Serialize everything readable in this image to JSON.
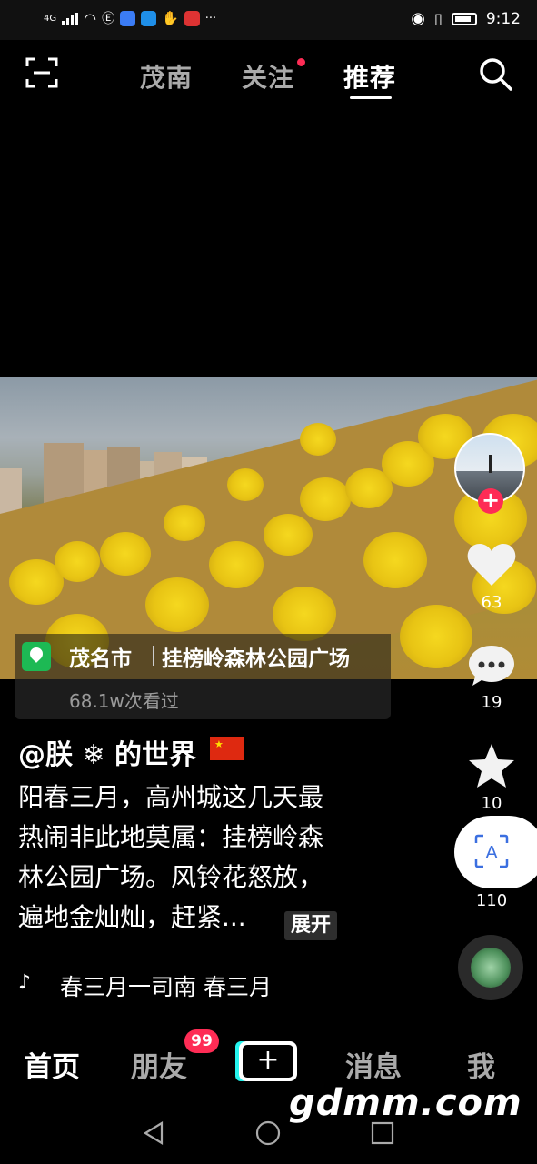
{
  "status_bar": {
    "network": "4G",
    "time": "9:12",
    "more": "···",
    "app_icon_colors": [
      "#3b7cf5",
      "#1f8fe8",
      "#d33"
    ]
  },
  "top_nav": {
    "tabs": [
      {
        "label": "茂南",
        "active": false
      },
      {
        "label": "关注",
        "active": false,
        "has_dot": true
      },
      {
        "label": "推荐",
        "active": true
      }
    ]
  },
  "location": {
    "city": "茂名市",
    "place": "挂榜岭森林公园广场",
    "views": "68.1w次看过"
  },
  "rail": {
    "likes": "63",
    "comments": "19",
    "favorites": "10",
    "shares": "110",
    "ocr_label": "A"
  },
  "post": {
    "author": "@朕 ❄ 的世界",
    "caption_lines": [
      "阳春三月，高州城这几天最",
      "热闹非此地莫属：挂榜岭森",
      "林公园广场。风铃花怒放，",
      "遍地金灿灿，赶紧..."
    ],
    "expand_label": "展开",
    "music": "春三月一司南    春三月"
  },
  "bottom_nav": {
    "items": [
      {
        "label": "首页",
        "active": true
      },
      {
        "label": "朋友",
        "active": false,
        "badge": "99"
      },
      {
        "label": "+",
        "active": false
      },
      {
        "label": "消息",
        "active": false
      },
      {
        "label": "我",
        "active": false
      }
    ]
  },
  "watermark": "gdmm.com",
  "colors": {
    "accent": "#fe2c55",
    "location_pin": "#1db954",
    "background": "#000000"
  }
}
